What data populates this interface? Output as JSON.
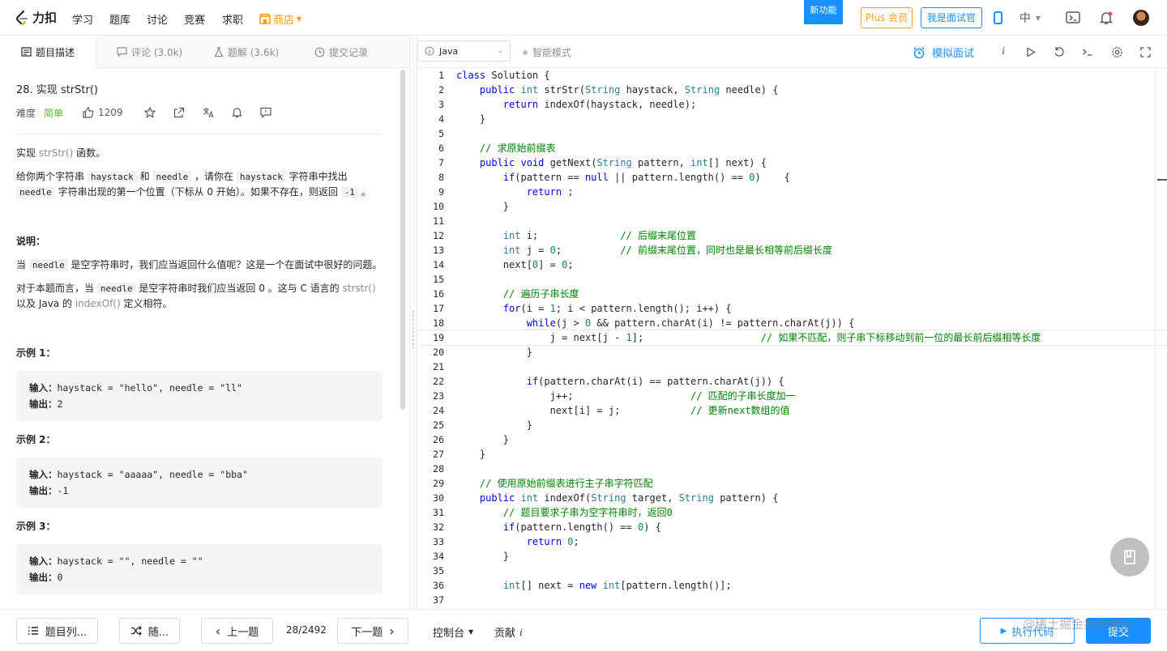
{
  "nav": {
    "logo": "力扣",
    "items": [
      "学习",
      "题库",
      "讨论",
      "竞赛",
      "求职"
    ],
    "shop": "商店",
    "new_feature": "新功能",
    "plus": "Plus 会员",
    "interviewer": "我是面试官",
    "lang": "中"
  },
  "left_tabs": {
    "description": "题目描述",
    "comments": "评论 (3.0k)",
    "solutions": "题解 (3.6k)",
    "submissions": "提交记录"
  },
  "problem": {
    "title": "28. 实现 strStr()",
    "difficulty_label": "难度",
    "difficulty": "简单",
    "likes": "1209",
    "intro_a": "实现 ",
    "intro_fn": "strStr()",
    "intro_b": " 函数。",
    "p1_a": "给你两个字符串 ",
    "p1_c1": "haystack",
    "p1_b": " 和 ",
    "p1_c2": "needle",
    "p1_c": " ，请你在 ",
    "p1_c3": "haystack",
    "p1_d": " 字符串中找出 ",
    "p1_c4": "needle",
    "p1_e": " 字符串出现的第一个位置（下标从 0 开始）。如果不存在，则返回 ",
    "p1_c5": "-1",
    "p1_f": " 。",
    "note_title": "说明：",
    "n1_a": "当 ",
    "n1_c": "needle",
    "n1_b": " 是空字符串时，我们应当返回什么值呢？这是一个在面试中很好的问题。",
    "n2_a": "对于本题而言，当 ",
    "n2_c": "needle",
    "n2_b": " 是空字符串时我们应当返回 0 。这与 C 语言的 ",
    "n2_f1": "strstr()",
    "n2_d": " 以及 Java 的 ",
    "n2_f2": "indexOf()",
    "n2_e": " 定义相符。",
    "examples": [
      {
        "title": "示例 1：",
        "in_label": "输入：",
        "input": "haystack = \"hello\", needle = \"ll\"",
        "out_label": "输出：",
        "output": "2"
      },
      {
        "title": "示例 2：",
        "in_label": "输入：",
        "input": "haystack = \"aaaaa\", needle = \"bba\"",
        "out_label": "输出：",
        "output": "-1"
      },
      {
        "title": "示例 3：",
        "in_label": "输入：",
        "input": "haystack = \"\", needle = \"\"",
        "out_label": "输出：",
        "output": "0"
      }
    ]
  },
  "editor": {
    "language": "Java",
    "smart_mode": "智能模式",
    "mock_interview": "模拟面试",
    "lines": [
      "class Solution {",
      "    public int strStr(String haystack, String needle) {",
      "        return indexOf(haystack, needle);",
      "    }",
      "",
      "    // 求原始前缀表",
      "    public void getNext(String pattern, int[] next) {",
      "        if(pattern == null || pattern.length() == 0)    {",
      "            return ;",
      "        }",
      "",
      "        int i;              // 后缀末尾位置",
      "        int j = 0;          // 前缀末尾位置，同时也是最长相等前后缀长度",
      "        next[0] = 0;",
      "",
      "        // 遍历子串长度",
      "        for(i = 1; i < pattern.length(); i++) {",
      "            while(j > 0 && pattern.charAt(i) != pattern.charAt(j)) {",
      "                j = next[j - 1];                    // 如果不匹配，则子串下标移动到前一位的最长前后缀相等长度",
      "            }",
      "",
      "            if(pattern.charAt(i) == pattern.charAt(j)) {",
      "                j++;                    // 匹配的子串长度加一",
      "                next[i] = j;            // 更新next数组的值",
      "            }",
      "        }",
      "    }",
      "",
      "    // 使用原始前缀表进行主子串字符匹配",
      "    public int indexOf(String target, String pattern) {",
      "        // 题目要求子串为空字符串时，返回0",
      "        if(pattern.length() == 0) {",
      "            return 0;",
      "        }",
      "",
      "        int[] next = new int[pattern.length()];",
      ""
    ],
    "current_line": 19
  },
  "bottom": {
    "problem_list": "题目列...",
    "random": "随...",
    "prev": "上一题",
    "counter": "28/2492",
    "next": "下一题",
    "console": "控制台",
    "contribute": "贡献",
    "run": "执行代码",
    "submit": "提交"
  },
  "watermark": "@稀土掘金技术社区",
  "colors": {
    "accent": "#1a90ff",
    "easy": "#5ab726",
    "plus": "#ffa116",
    "shop": "#ff9a00"
  }
}
